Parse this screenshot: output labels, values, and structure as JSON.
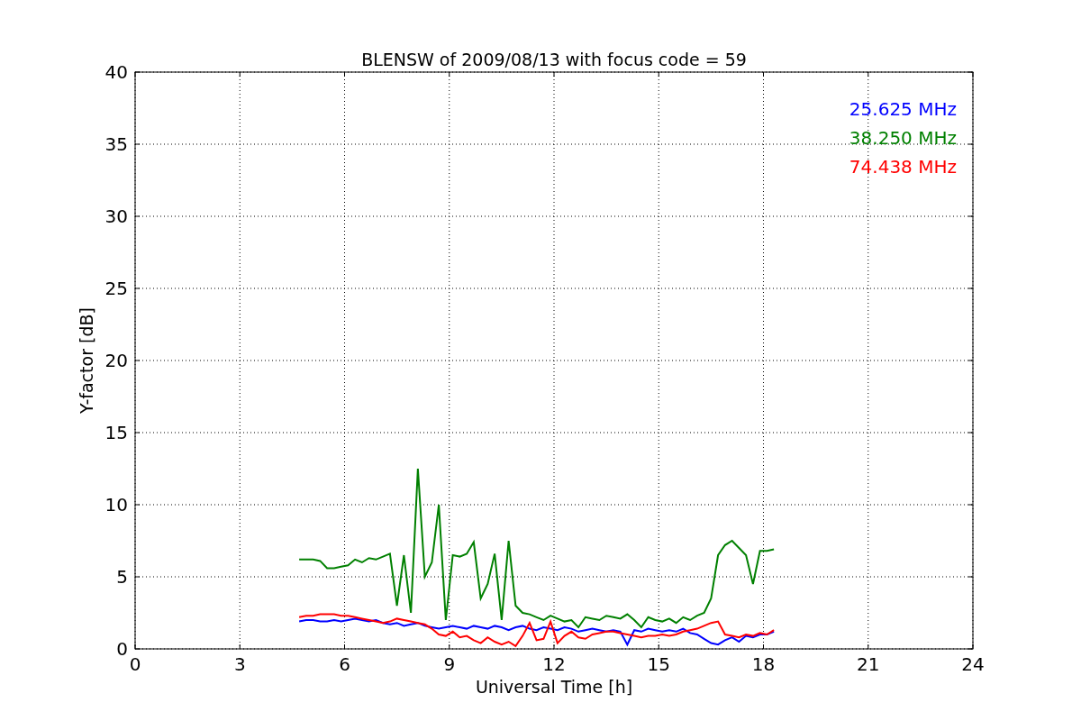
{
  "chart_data": {
    "type": "line",
    "title": "BLENSW of 2009/08/13 with focus code = 59",
    "xlabel": "Universal Time [h]",
    "ylabel": "Y-factor [dB]",
    "x": [
      4.7,
      4.9,
      5.1,
      5.3,
      5.5,
      5.7,
      5.9,
      6.1,
      6.3,
      6.5,
      6.7,
      6.9,
      7.1,
      7.3,
      7.5,
      7.7,
      7.9,
      8.1,
      8.3,
      8.5,
      8.7,
      8.9,
      9.1,
      9.3,
      9.5,
      9.7,
      9.9,
      10.1,
      10.3,
      10.5,
      10.7,
      10.9,
      11.1,
      11.3,
      11.5,
      11.7,
      11.9,
      12.1,
      12.3,
      12.5,
      12.7,
      12.9,
      13.1,
      13.3,
      13.5,
      13.7,
      13.9,
      14.1,
      14.3,
      14.5,
      14.7,
      14.9,
      15.1,
      15.3,
      15.5,
      15.7,
      15.9,
      16.1,
      16.3,
      16.5,
      16.7,
      16.9,
      17.1,
      17.3,
      17.5,
      17.7,
      17.9,
      18.1,
      18.3
    ],
    "series": [
      {
        "name": "25.625 MHz",
        "color": "#0000ff",
        "values": [
          1.9,
          2.0,
          2.0,
          1.9,
          1.9,
          2.0,
          1.9,
          2.0,
          2.1,
          2.0,
          1.9,
          2.0,
          1.8,
          1.7,
          1.8,
          1.6,
          1.7,
          1.8,
          1.6,
          1.5,
          1.4,
          1.5,
          1.6,
          1.5,
          1.4,
          1.6,
          1.5,
          1.4,
          1.6,
          1.5,
          1.3,
          1.5,
          1.6,
          1.4,
          1.3,
          1.5,
          1.4,
          1.3,
          1.5,
          1.4,
          1.2,
          1.3,
          1.4,
          1.3,
          1.2,
          1.3,
          1.2,
          0.3,
          1.3,
          1.2,
          1.4,
          1.3,
          1.2,
          1.3,
          1.2,
          1.4,
          1.1,
          1.0,
          0.7,
          0.4,
          0.3,
          0.6,
          0.8,
          0.5,
          0.9,
          0.8,
          1.0,
          1.0,
          1.2
        ]
      },
      {
        "name": "38.250 MHz",
        "color": "#008000",
        "values": [
          6.2,
          6.2,
          6.2,
          6.1,
          5.6,
          5.6,
          5.7,
          5.8,
          6.2,
          6.0,
          6.3,
          6.2,
          6.4,
          6.6,
          3.0,
          6.5,
          2.5,
          12.5,
          5.0,
          6.0,
          10.0,
          2.0,
          6.5,
          6.4,
          6.6,
          7.4,
          3.5,
          4.5,
          6.6,
          2.0,
          7.5,
          3.0,
          2.5,
          2.4,
          2.2,
          2.0,
          2.3,
          2.1,
          1.9,
          2.0,
          1.5,
          2.2,
          2.1,
          2.0,
          2.3,
          2.2,
          2.1,
          2.4,
          2.0,
          1.5,
          2.2,
          2.0,
          1.9,
          2.1,
          1.8,
          2.2,
          2.0,
          2.3,
          2.5,
          3.5,
          6.5,
          7.2,
          7.5,
          7.0,
          6.5,
          4.5,
          6.8,
          6.8,
          6.9
        ]
      },
      {
        "name": "74.438 MHz",
        "color": "#ff0000",
        "values": [
          2.2,
          2.3,
          2.3,
          2.4,
          2.4,
          2.4,
          2.3,
          2.3,
          2.2,
          2.1,
          2.0,
          1.9,
          1.8,
          1.9,
          2.1,
          2.0,
          1.9,
          1.8,
          1.7,
          1.4,
          1.0,
          0.9,
          1.2,
          0.8,
          0.9,
          0.6,
          0.4,
          0.8,
          0.5,
          0.3,
          0.5,
          0.2,
          0.9,
          1.8,
          0.6,
          0.7,
          1.9,
          0.4,
          0.9,
          1.2,
          0.8,
          0.7,
          1.0,
          1.1,
          1.2,
          1.2,
          1.1,
          1.0,
          0.9,
          0.8,
          0.9,
          0.9,
          1.0,
          0.9,
          1.0,
          1.2,
          1.3,
          1.4,
          1.6,
          1.8,
          1.9,
          1.0,
          0.9,
          0.8,
          1.0,
          0.9,
          1.1,
          1.0,
          1.3
        ]
      }
    ],
    "grid": true,
    "xlim": [
      0,
      24
    ],
    "ylim": [
      0,
      40
    ],
    "xticks": [
      0,
      3,
      6,
      9,
      12,
      15,
      18,
      21,
      24
    ],
    "yticks": [
      0,
      5,
      10,
      15,
      20,
      25,
      30,
      35,
      40
    ]
  }
}
